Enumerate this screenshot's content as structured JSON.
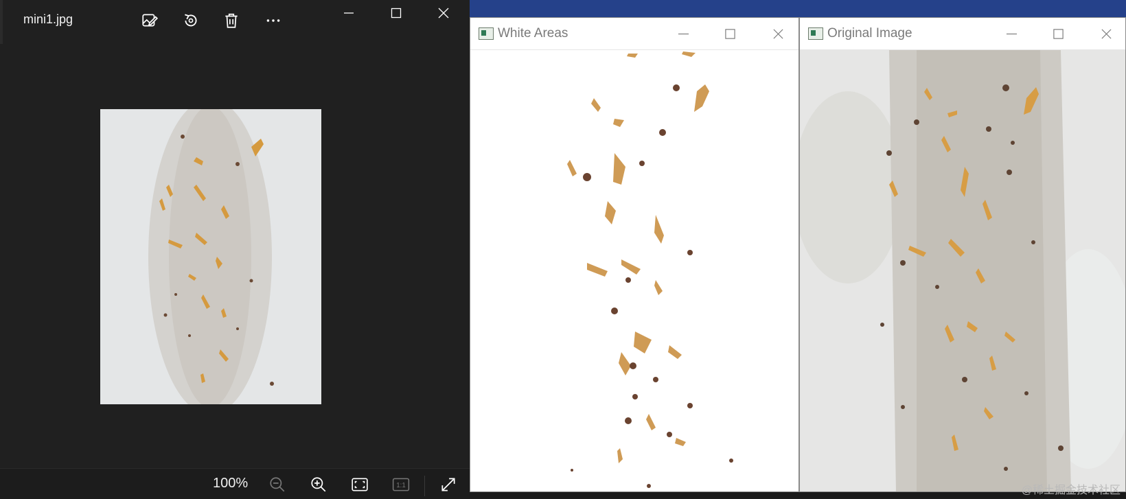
{
  "photos_app": {
    "file_name": "mini1.jpg",
    "zoom_level": "100%",
    "ratio_label": "1:1",
    "toolbar": [
      {
        "name": "edit-image-icon"
      },
      {
        "name": "rotate-icon"
      },
      {
        "name": "delete-icon"
      },
      {
        "name": "more-options-icon"
      }
    ]
  },
  "windows": {
    "white_areas": {
      "title": "White Areas"
    },
    "original_image": {
      "title": "Original Image"
    }
  },
  "watermark": "@稀土掘金技术社区",
  "colors": {
    "photos_bg": "#202020",
    "taskbar_blue": "#25418a",
    "window_bg": "#ffffff",
    "title_text": "#7a7a7a"
  }
}
